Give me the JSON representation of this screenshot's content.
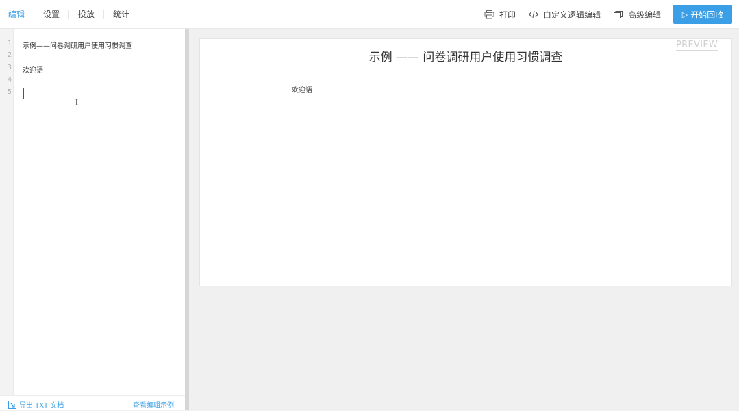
{
  "tabs": [
    {
      "label": "编辑",
      "active": true
    },
    {
      "label": "设置",
      "active": false
    },
    {
      "label": "投放",
      "active": false
    },
    {
      "label": "统计",
      "active": false
    }
  ],
  "actions": {
    "print": {
      "label": "打印",
      "icon": "printer-icon"
    },
    "custom_logic": {
      "label": "自定义逻辑编辑",
      "icon": "code-icon"
    },
    "advanced": {
      "label": "高级编辑",
      "icon": "window-icon"
    },
    "start": {
      "label": "开始回收",
      "icon": "play-icon"
    }
  },
  "editor": {
    "line_numbers": [
      "1",
      "2",
      "3",
      "4",
      "5"
    ],
    "lines": [
      "示例——问卷调研用户使用习惯调查",
      "",
      "欢迎语",
      "",
      ""
    ],
    "footer": {
      "export_label": "导出 TXT 文档",
      "view_example_label": "查看编辑示例"
    }
  },
  "preview": {
    "badge": "PREVIEW",
    "title": "示例 —— 问卷调研用户使用习惯调查",
    "welcome": "欢迎语"
  },
  "colors": {
    "accent": "#3a9fe6",
    "background": "#f0f0f0"
  }
}
